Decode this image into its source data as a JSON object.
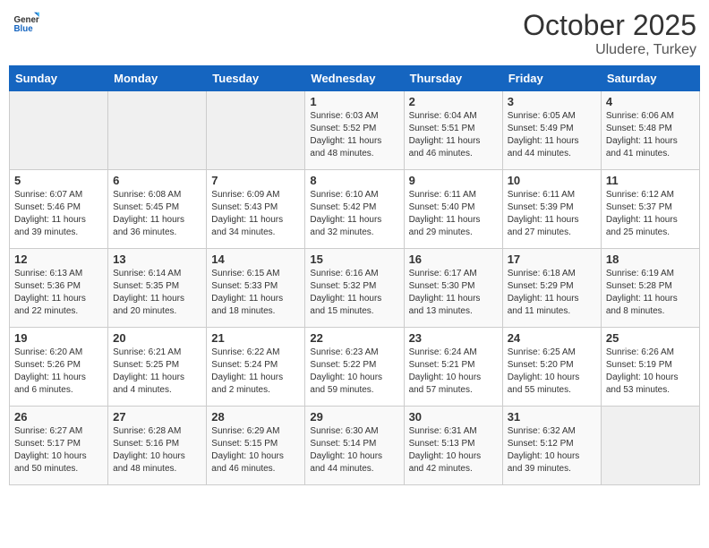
{
  "header": {
    "logo_general": "General",
    "logo_blue": "Blue",
    "month": "October 2025",
    "location": "Uludere, Turkey"
  },
  "weekdays": [
    "Sunday",
    "Monday",
    "Tuesday",
    "Wednesday",
    "Thursday",
    "Friday",
    "Saturday"
  ],
  "weeks": [
    [
      {
        "day": "",
        "info": ""
      },
      {
        "day": "",
        "info": ""
      },
      {
        "day": "",
        "info": ""
      },
      {
        "day": "1",
        "info": "Sunrise: 6:03 AM\nSunset: 5:52 PM\nDaylight: 11 hours\nand 48 minutes."
      },
      {
        "day": "2",
        "info": "Sunrise: 6:04 AM\nSunset: 5:51 PM\nDaylight: 11 hours\nand 46 minutes."
      },
      {
        "day": "3",
        "info": "Sunrise: 6:05 AM\nSunset: 5:49 PM\nDaylight: 11 hours\nand 44 minutes."
      },
      {
        "day": "4",
        "info": "Sunrise: 6:06 AM\nSunset: 5:48 PM\nDaylight: 11 hours\nand 41 minutes."
      }
    ],
    [
      {
        "day": "5",
        "info": "Sunrise: 6:07 AM\nSunset: 5:46 PM\nDaylight: 11 hours\nand 39 minutes."
      },
      {
        "day": "6",
        "info": "Sunrise: 6:08 AM\nSunset: 5:45 PM\nDaylight: 11 hours\nand 36 minutes."
      },
      {
        "day": "7",
        "info": "Sunrise: 6:09 AM\nSunset: 5:43 PM\nDaylight: 11 hours\nand 34 minutes."
      },
      {
        "day": "8",
        "info": "Sunrise: 6:10 AM\nSunset: 5:42 PM\nDaylight: 11 hours\nand 32 minutes."
      },
      {
        "day": "9",
        "info": "Sunrise: 6:11 AM\nSunset: 5:40 PM\nDaylight: 11 hours\nand 29 minutes."
      },
      {
        "day": "10",
        "info": "Sunrise: 6:11 AM\nSunset: 5:39 PM\nDaylight: 11 hours\nand 27 minutes."
      },
      {
        "day": "11",
        "info": "Sunrise: 6:12 AM\nSunset: 5:37 PM\nDaylight: 11 hours\nand 25 minutes."
      }
    ],
    [
      {
        "day": "12",
        "info": "Sunrise: 6:13 AM\nSunset: 5:36 PM\nDaylight: 11 hours\nand 22 minutes."
      },
      {
        "day": "13",
        "info": "Sunrise: 6:14 AM\nSunset: 5:35 PM\nDaylight: 11 hours\nand 20 minutes."
      },
      {
        "day": "14",
        "info": "Sunrise: 6:15 AM\nSunset: 5:33 PM\nDaylight: 11 hours\nand 18 minutes."
      },
      {
        "day": "15",
        "info": "Sunrise: 6:16 AM\nSunset: 5:32 PM\nDaylight: 11 hours\nand 15 minutes."
      },
      {
        "day": "16",
        "info": "Sunrise: 6:17 AM\nSunset: 5:30 PM\nDaylight: 11 hours\nand 13 minutes."
      },
      {
        "day": "17",
        "info": "Sunrise: 6:18 AM\nSunset: 5:29 PM\nDaylight: 11 hours\nand 11 minutes."
      },
      {
        "day": "18",
        "info": "Sunrise: 6:19 AM\nSunset: 5:28 PM\nDaylight: 11 hours\nand 8 minutes."
      }
    ],
    [
      {
        "day": "19",
        "info": "Sunrise: 6:20 AM\nSunset: 5:26 PM\nDaylight: 11 hours\nand 6 minutes."
      },
      {
        "day": "20",
        "info": "Sunrise: 6:21 AM\nSunset: 5:25 PM\nDaylight: 11 hours\nand 4 minutes."
      },
      {
        "day": "21",
        "info": "Sunrise: 6:22 AM\nSunset: 5:24 PM\nDaylight: 11 hours\nand 2 minutes."
      },
      {
        "day": "22",
        "info": "Sunrise: 6:23 AM\nSunset: 5:22 PM\nDaylight: 10 hours\nand 59 minutes."
      },
      {
        "day": "23",
        "info": "Sunrise: 6:24 AM\nSunset: 5:21 PM\nDaylight: 10 hours\nand 57 minutes."
      },
      {
        "day": "24",
        "info": "Sunrise: 6:25 AM\nSunset: 5:20 PM\nDaylight: 10 hours\nand 55 minutes."
      },
      {
        "day": "25",
        "info": "Sunrise: 6:26 AM\nSunset: 5:19 PM\nDaylight: 10 hours\nand 53 minutes."
      }
    ],
    [
      {
        "day": "26",
        "info": "Sunrise: 6:27 AM\nSunset: 5:17 PM\nDaylight: 10 hours\nand 50 minutes."
      },
      {
        "day": "27",
        "info": "Sunrise: 6:28 AM\nSunset: 5:16 PM\nDaylight: 10 hours\nand 48 minutes."
      },
      {
        "day": "28",
        "info": "Sunrise: 6:29 AM\nSunset: 5:15 PM\nDaylight: 10 hours\nand 46 minutes."
      },
      {
        "day": "29",
        "info": "Sunrise: 6:30 AM\nSunset: 5:14 PM\nDaylight: 10 hours\nand 44 minutes."
      },
      {
        "day": "30",
        "info": "Sunrise: 6:31 AM\nSunset: 5:13 PM\nDaylight: 10 hours\nand 42 minutes."
      },
      {
        "day": "31",
        "info": "Sunrise: 6:32 AM\nSunset: 5:12 PM\nDaylight: 10 hours\nand 39 minutes."
      },
      {
        "day": "",
        "info": ""
      }
    ]
  ]
}
